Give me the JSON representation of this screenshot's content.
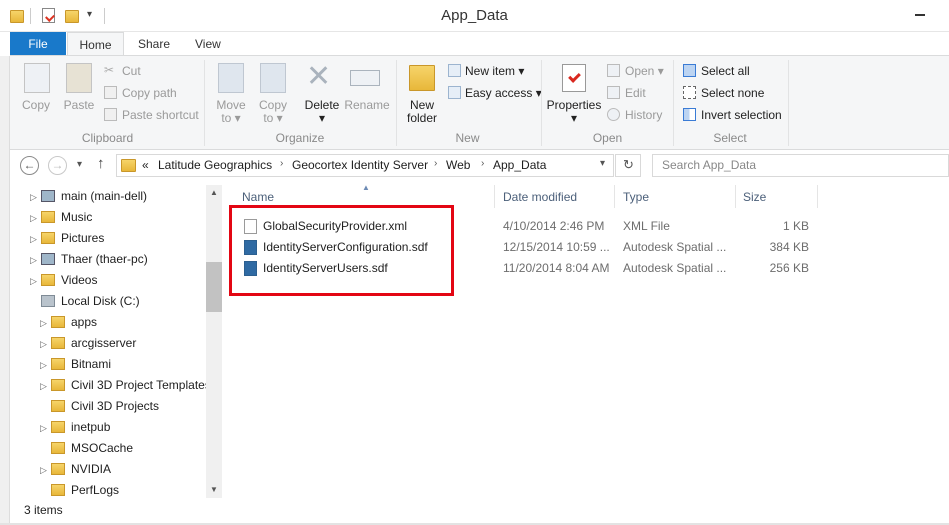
{
  "window": {
    "title": "App_Data"
  },
  "ribbon": {
    "tabs": [
      "File",
      "Home",
      "Share",
      "View"
    ],
    "clipboard": {
      "copy": "Copy",
      "paste": "Paste",
      "cut": "Cut",
      "copy_path": "Copy path",
      "paste_shortcut": "Paste shortcut",
      "label": "Clipboard"
    },
    "organize": {
      "move_to_1": "Move",
      "move_to_2": "to",
      "copy_to_1": "Copy",
      "copy_to_2": "to",
      "delete": "Delete",
      "rename": "Rename",
      "label": "Organize"
    },
    "new": {
      "new_folder_1": "New",
      "new_folder_2": "folder",
      "new_item": "New item",
      "easy_access": "Easy access",
      "label": "New"
    },
    "open": {
      "properties": "Properties",
      "open": "Open",
      "edit": "Edit",
      "history": "History",
      "label": "Open"
    },
    "select": {
      "select_all": "Select all",
      "select_none": "Select none",
      "invert_selection": "Invert selection",
      "label": "Select"
    }
  },
  "address": {
    "prefix": "«",
    "crumbs": [
      "Latitude Geographics",
      "Geocortex Identity Server",
      "Web",
      "App_Data"
    ],
    "search_placeholder": "Search App_Data"
  },
  "nav": {
    "items": [
      {
        "label": "main (main-dell)",
        "icon": "network-computer-icon"
      },
      {
        "label": "Music",
        "icon": "music-folder-icon"
      },
      {
        "label": "Pictures",
        "icon": "pictures-folder-icon"
      },
      {
        "label": "Thaer (thaer-pc)",
        "icon": "network-computer-icon"
      },
      {
        "label": "Videos",
        "icon": "videos-folder-icon"
      },
      {
        "label": "Local Disk (C:)",
        "icon": "drive-icon"
      },
      {
        "label": "apps",
        "icon": "folder-icon"
      },
      {
        "label": "arcgisserver",
        "icon": "folder-icon"
      },
      {
        "label": "Bitnami",
        "icon": "folder-icon"
      },
      {
        "label": "Civil 3D Project Templates",
        "icon": "folder-icon"
      },
      {
        "label": "Civil 3D Projects",
        "icon": "folder-icon"
      },
      {
        "label": "inetpub",
        "icon": "folder-icon"
      },
      {
        "label": "MSOCache",
        "icon": "folder-icon"
      },
      {
        "label": "NVIDIA",
        "icon": "folder-icon"
      },
      {
        "label": "PerfLogs",
        "icon": "folder-icon"
      }
    ]
  },
  "filelist": {
    "columns": {
      "name": "Name",
      "date": "Date modified",
      "type": "Type",
      "size": "Size"
    },
    "rows": [
      {
        "name": "GlobalSecurityProvider.xml",
        "date": "4/10/2014 2:46 PM",
        "type": "XML File",
        "size": "1 KB"
      },
      {
        "name": "IdentityServerConfiguration.sdf",
        "date": "12/15/2014 10:59 ...",
        "type": "Autodesk Spatial ...",
        "size": "384 KB"
      },
      {
        "name": "IdentityServerUsers.sdf",
        "date": "11/20/2014 8:04 AM",
        "type": "Autodesk Spatial ...",
        "size": "256 KB"
      }
    ]
  },
  "status": {
    "count": "3 items"
  },
  "colors": {
    "file_tab": "#1979ca",
    "highlight_box": "#e30613"
  }
}
